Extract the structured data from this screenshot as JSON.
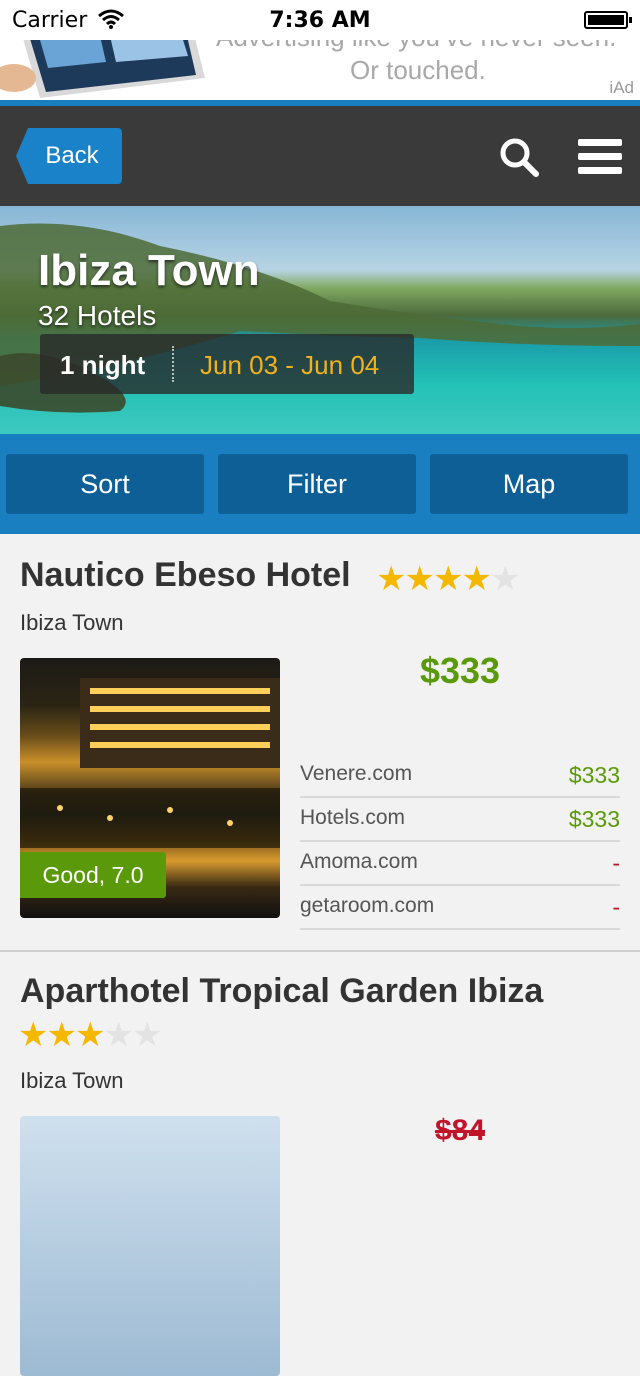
{
  "status_bar": {
    "carrier": "Carrier",
    "time": "7:36 AM"
  },
  "ad": {
    "line1": "Advertising like you’ve never seen.",
    "line2": "Or touched.",
    "label": "iAd"
  },
  "navbar": {
    "back_label": "Back"
  },
  "hero": {
    "city": "Ibiza Town",
    "count": "32 Hotels",
    "nights": "1 night",
    "dates": "Jun 03 - Jun 04"
  },
  "actions": {
    "sort": "Sort",
    "filter": "Filter",
    "map": "Map"
  },
  "hotels": [
    {
      "name": "Nautico Ebeso Hotel",
      "stars": 4,
      "stars_max": 5,
      "location": "Ibiza Town",
      "rating": "Good, 7.0",
      "price": "$333",
      "providers": [
        {
          "site": "Venere.com",
          "price": "$333"
        },
        {
          "site": "Hotels.com",
          "price": "$333"
        },
        {
          "site": "Amoma.com",
          "price": "-"
        },
        {
          "site": "getaroom.com",
          "price": "-"
        }
      ]
    },
    {
      "name": "Aparthotel Tropical Garden Ibiza",
      "stars": 3,
      "stars_max": 5,
      "location": "Ibiza Town",
      "price": "$84"
    }
  ],
  "colors": {
    "accent_blue": "#1a7fc1",
    "price_green": "#5a9a0a",
    "price_red": "#c0142a",
    "star": "#f5b800"
  }
}
